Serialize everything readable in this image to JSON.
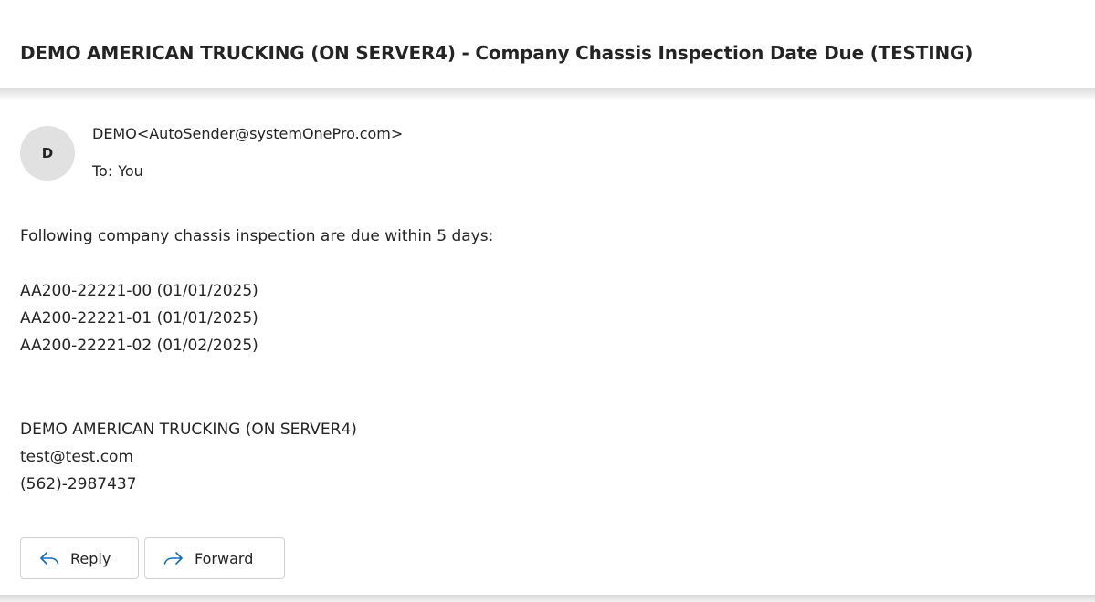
{
  "message": {
    "subject": "DEMO AMERICAN TRUCKING (ON SERVER4) - Company Chassis Inspection Date Due (TESTING)",
    "sender": {
      "initial": "D",
      "display": "DEMO<AutoSender@systemOnePro.com>"
    },
    "recipients": {
      "label": "To:",
      "value": "You"
    },
    "body": {
      "intro": "Following company chassis inspection are due within 5 days:",
      "items": [
        "AA200-22221-00 (01/01/2025)",
        "AA200-22221-01 (01/01/2025)",
        "AA200-22221-02 (01/02/2025)"
      ],
      "signature": [
        "DEMO AMERICAN TRUCKING (ON SERVER4)",
        "test@test.com",
        "(562)-2987437"
      ]
    }
  },
  "actions": {
    "reply": {
      "label": "Reply",
      "icon": "reply-arrow-icon"
    },
    "forward": {
      "label": "Forward",
      "icon": "forward-arrow-icon"
    }
  },
  "colors": {
    "accent": "#0f6cbd",
    "avatar_bg": "#e1e1e1",
    "text": "#242424"
  }
}
